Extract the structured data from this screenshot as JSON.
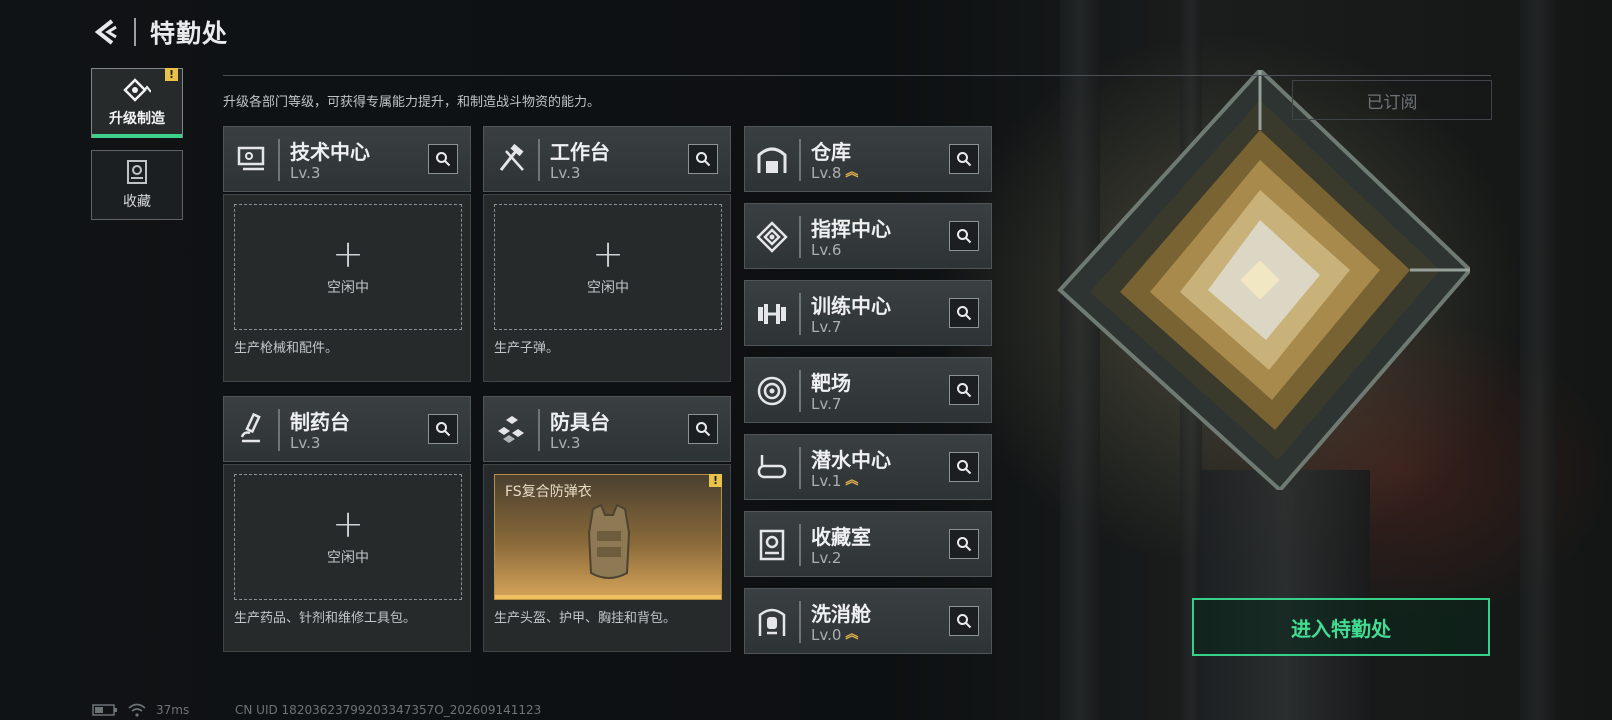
{
  "header": {
    "title": "特勤处",
    "back_icon": "back-arrow-icon"
  },
  "side_tabs": [
    {
      "label": "升级制造",
      "icon": "upgrade-icon",
      "active": true,
      "badge": "!"
    },
    {
      "label": "收藏",
      "icon": "collection-icon",
      "active": false
    }
  ],
  "description": "升级各部门等级，可获得专属能力提升，和制造战斗物资的能力。",
  "subscribed_label": "已订阅",
  "facilities": [
    {
      "name": "技术中心",
      "level": "Lv.3",
      "icon": "tech-center-icon",
      "slot_status": "空闲中",
      "desc": "生产枪械和配件。"
    },
    {
      "name": "工作台",
      "level": "Lv.3",
      "icon": "workbench-icon",
      "slot_status": "空闲中",
      "desc": "生产子弹。"
    },
    {
      "name": "制药台",
      "level": "Lv.3",
      "icon": "pharmacy-icon",
      "slot_status": "空闲中",
      "desc": "生产药品、针剂和维修工具包。"
    },
    {
      "name": "防具台",
      "level": "Lv.3",
      "icon": "armor-bench-icon",
      "item_name": "FS复合防弹衣",
      "item_badge": "!",
      "desc": "生产头盔、护甲、胸挂和背包。"
    }
  ],
  "side_facilities": [
    {
      "name": "仓库",
      "level": "Lv.8",
      "icon": "warehouse-icon",
      "upgradable": true
    },
    {
      "name": "指挥中心",
      "level": "Lv.6",
      "icon": "command-center-icon",
      "upgradable": false
    },
    {
      "name": "训练中心",
      "level": "Lv.7",
      "icon": "training-center-icon",
      "upgradable": false
    },
    {
      "name": "靶场",
      "level": "Lv.7",
      "icon": "shooting-range-icon",
      "upgradable": false
    },
    {
      "name": "潜水中心",
      "level": "Lv.1",
      "icon": "diving-center-icon",
      "upgradable": true
    },
    {
      "name": "收藏室",
      "level": "Lv.2",
      "icon": "collection-room-icon",
      "upgradable": false
    },
    {
      "name": "洗消舱",
      "level": "Lv.0",
      "icon": "decontamination-icon",
      "upgradable": true
    }
  ],
  "enter_button": "进入特勤处",
  "status": {
    "ping": "37ms",
    "uid": "CN UID 18203623799203347357O_202609141123"
  },
  "colors": {
    "accent": "#3fd08a",
    "warn": "#e8c24a",
    "upgrade": "#e3b34c"
  }
}
